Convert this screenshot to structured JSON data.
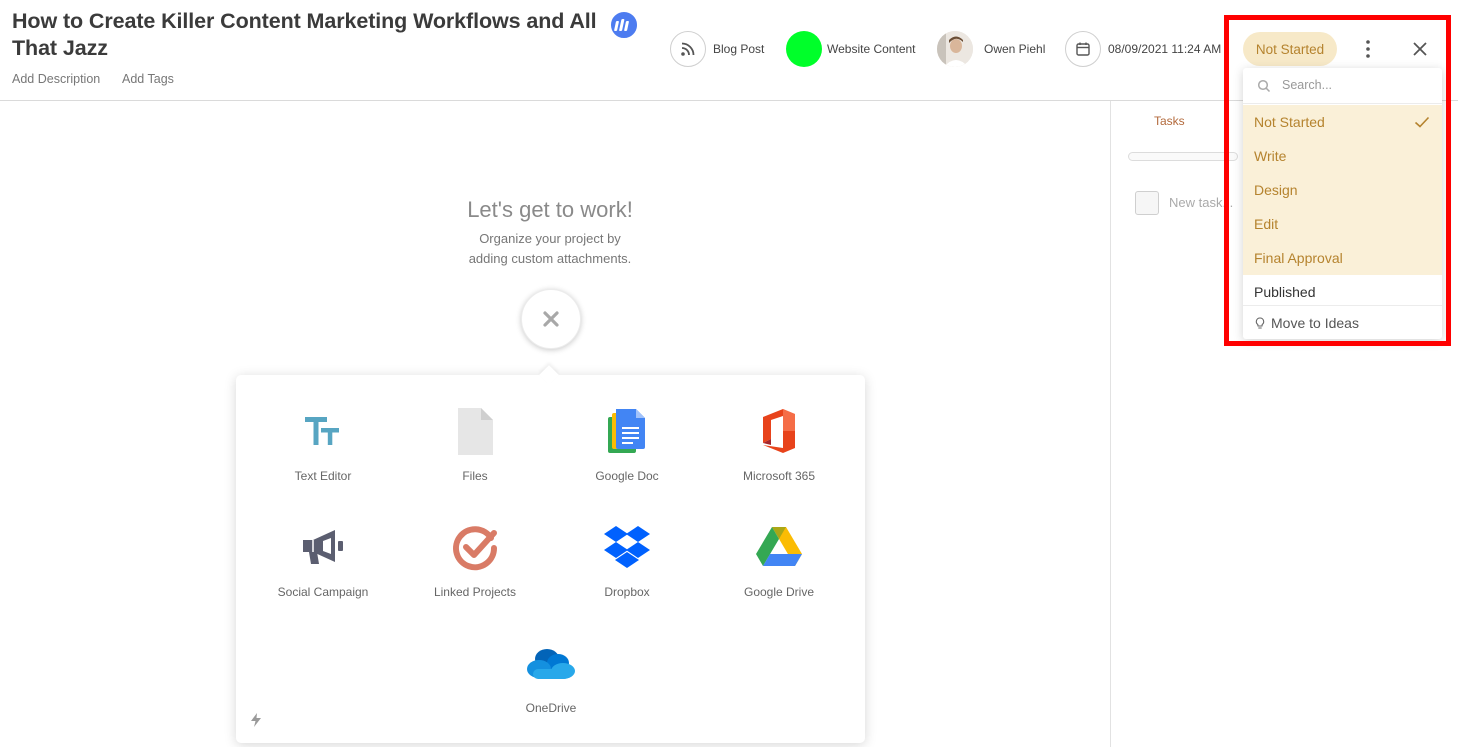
{
  "header": {
    "title": "How to Create Killer Content Marketing Workflows and All That Jazz",
    "add_description": "Add Description",
    "add_tags": "Add Tags"
  },
  "meta": {
    "content_type": "Blog Post",
    "calendar": "Website Content",
    "calendar_color": "#00ff2a",
    "owner": "Owen Piehl",
    "due_date": "08/09/2021 11:24 AM"
  },
  "status": {
    "current": "Not Started",
    "search_placeholder": "Search...",
    "options": [
      {
        "label": "Not Started",
        "selected": true
      },
      {
        "label": "Write",
        "selected": false
      },
      {
        "label": "Design",
        "selected": false
      },
      {
        "label": "Edit",
        "selected": false
      },
      {
        "label": "Final Approval",
        "selected": false
      },
      {
        "label": "Published",
        "selected": false
      }
    ],
    "move_to_ideas": "Move to Ideas"
  },
  "tasks": {
    "tab_label": "Tasks",
    "new_task_placeholder": "New task..."
  },
  "empty_state": {
    "title": "Let's get to work!",
    "line1": "Organize your project by",
    "line2": "adding custom attachments."
  },
  "attachments": [
    {
      "label": "Text Editor",
      "icon": "text-editor-icon"
    },
    {
      "label": "Files",
      "icon": "files-icon"
    },
    {
      "label": "Google Doc",
      "icon": "google-doc-icon"
    },
    {
      "label": "Microsoft 365",
      "icon": "microsoft-365-icon"
    },
    {
      "label": "Social Campaign",
      "icon": "megaphone-icon"
    },
    {
      "label": "Linked Projects",
      "icon": "linked-projects-icon"
    },
    {
      "label": "Dropbox",
      "icon": "dropbox-icon"
    },
    {
      "label": "Google Drive",
      "icon": "google-drive-icon"
    },
    {
      "label": "OneDrive",
      "icon": "onedrive-icon"
    }
  ],
  "colors": {
    "status_bg": "#f7e9c8",
    "status_text": "#b5832e",
    "highlight": "#ff0000",
    "tasks_tab": "#b36a3c"
  }
}
